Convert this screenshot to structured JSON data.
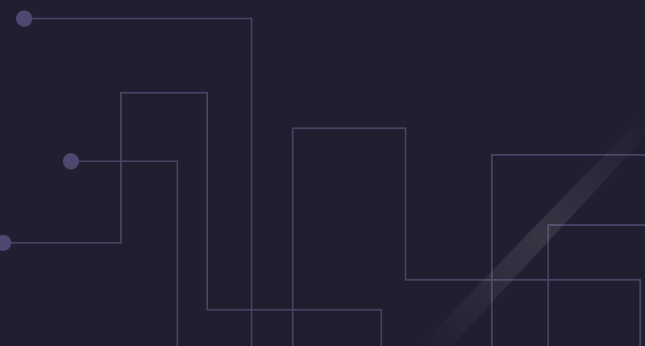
{
  "background": {
    "color": "#221e30",
    "line_color": "#4a4366",
    "node_color": "#4f4870",
    "highlight_color": "#ffffff"
  }
}
